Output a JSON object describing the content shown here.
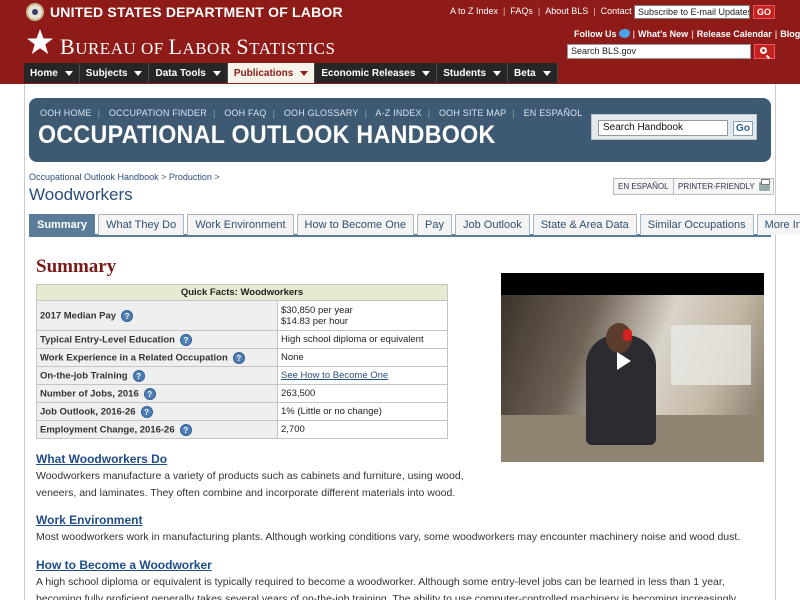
{
  "header": {
    "dol_title": "UNITED STATES DEPARTMENT OF LABOR",
    "util_links": [
      "A to Z Index",
      "FAQs",
      "About BLS",
      "Contact Us"
    ],
    "email_placeholder": "Subscribe to E-mail Updates",
    "go_label": "GO",
    "bls_title_big_1": "B",
    "bls_title_small_1": "UREAU OF ",
    "bls_title_big_2": "L",
    "bls_title_small_2": "ABOR ",
    "bls_title_big_3": "S",
    "bls_title_small_3": "TATISTICS",
    "social": [
      "Follow Us",
      "What's New",
      "Release Calendar",
      "Blog"
    ],
    "search_placeholder": "Search BLS.gov"
  },
  "nav": [
    {
      "label": "Home"
    },
    {
      "label": "Subjects"
    },
    {
      "label": "Data Tools"
    },
    {
      "label": "Publications"
    },
    {
      "label": "Economic Releases"
    },
    {
      "label": "Students"
    },
    {
      "label": "Beta"
    }
  ],
  "ooh": {
    "links": [
      "OOH HOME",
      "OCCUPATION FINDER",
      "OOH FAQ",
      "OOH GLOSSARY",
      "A-Z INDEX",
      "OOH SITE MAP",
      "EN ESPAÑOL"
    ],
    "title": "OCCUPATIONAL OUTLOOK HANDBOOK",
    "search_placeholder": "Search Handbook",
    "go_label": "Go"
  },
  "page": {
    "breadcrumb_1": "Occupational Outlook Handbook",
    "breadcrumb_2": "Production",
    "title": "Woodworkers",
    "lang_label": "EN ESPAÑOL",
    "print_label": "PRINTER-FRIENDLY"
  },
  "tabs": [
    "Summary",
    "What They Do",
    "Work Environment",
    "How to Become One",
    "Pay",
    "Job Outlook",
    "State & Area Data",
    "Similar Occupations",
    "More Info"
  ],
  "summary": {
    "heading": "Summary",
    "table_title": "Quick Facts: Woodworkers",
    "rows": [
      {
        "label": "2017 Median Pay",
        "value": "$30,850 per year",
        "value2": "$14.83 per hour"
      },
      {
        "label": "Typical Entry-Level Education",
        "value": "High school diploma or equivalent"
      },
      {
        "label": "Work Experience in a Related Occupation",
        "value": "None"
      },
      {
        "label": "On-the-job Training",
        "value": "See How to Become One"
      },
      {
        "label": "Number of Jobs, 2016",
        "value": "263,500"
      },
      {
        "label": "Job Outlook, 2016-26",
        "value": "1% (Little or no change)"
      },
      {
        "label": "Employment Change, 2016-26",
        "value": "2,700"
      }
    ]
  },
  "sections": [
    {
      "title": "What Woodworkers Do",
      "text": "Woodworkers manufacture a variety of products such as cabinets and furniture, using wood, veneers, and laminates. They often combine and incorporate different materials into wood."
    },
    {
      "title": "Work Environment",
      "text": "Most woodworkers work in manufacturing plants. Although working conditions vary, some woodworkers may encounter machinery noise and wood dust."
    },
    {
      "title": "How to Become a Woodworker",
      "text": "A high school diploma or equivalent is typically required to become a woodworker. Although some entry-level jobs can be learned in less than 1 year, becoming fully proficient generally takes several years of on-the-job training. The ability to use computer-controlled machinery is becoming increasingly important."
    }
  ]
}
